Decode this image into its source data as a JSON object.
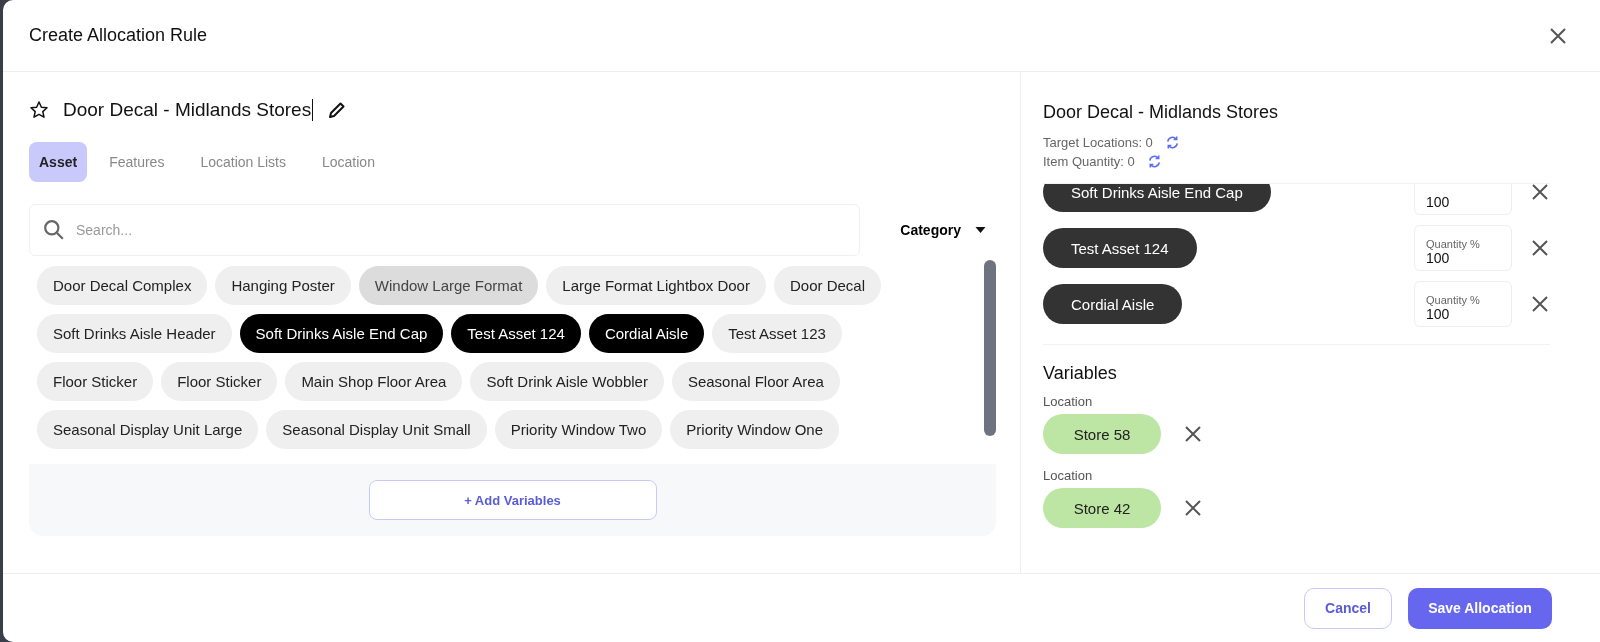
{
  "dialog": {
    "title": "Create Allocation Rule"
  },
  "rule": {
    "name": "Door Decal - Midlands Stores",
    "starred": false
  },
  "tabs": [
    {
      "label": "Asset",
      "selected": true
    },
    {
      "label": "Features",
      "selected": false
    },
    {
      "label": "Location Lists",
      "selected": false
    },
    {
      "label": "Location",
      "selected": false
    }
  ],
  "search": {
    "placeholder": "Search..."
  },
  "filter": {
    "label": "Category"
  },
  "assets": [
    {
      "label": "Door Decal Complex",
      "selected": false,
      "highlighted": false
    },
    {
      "label": "Hanging Poster",
      "selected": false,
      "highlighted": false
    },
    {
      "label": "Window Large Format",
      "selected": false,
      "highlighted": true
    },
    {
      "label": "Large Format Lightbox Door",
      "selected": false,
      "highlighted": false
    },
    {
      "label": "Door Decal",
      "selected": false,
      "highlighted": false
    },
    {
      "label": "Soft Drinks Aisle Header",
      "selected": false,
      "highlighted": false
    },
    {
      "label": "Soft Drinks Aisle End Cap",
      "selected": true,
      "highlighted": false
    },
    {
      "label": "Test Asset 124",
      "selected": true,
      "highlighted": false
    },
    {
      "label": "Cordial Aisle",
      "selected": true,
      "highlighted": false
    },
    {
      "label": "Test Asset 123",
      "selected": false,
      "highlighted": false
    },
    {
      "label": "Floor Sticker",
      "selected": false,
      "highlighted": false
    },
    {
      "label": "Floor Sticker",
      "selected": false,
      "highlighted": false
    },
    {
      "label": "Main Shop Floor Area",
      "selected": false,
      "highlighted": false
    },
    {
      "label": "Soft Drink Aisle Wobbler",
      "selected": false,
      "highlighted": false
    },
    {
      "label": "Seasonal Floor Area",
      "selected": false,
      "highlighted": false
    },
    {
      "label": "Seasonal Display Unit Large",
      "selected": false,
      "highlighted": false
    },
    {
      "label": "Seasonal Display Unit Small",
      "selected": false,
      "highlighted": false
    },
    {
      "label": "Priority Window Two",
      "selected": false,
      "highlighted": false
    },
    {
      "label": "Priority Window One",
      "selected": false,
      "highlighted": false
    }
  ],
  "add_variables": "+ Add Variables",
  "summary": {
    "title": "Door Decal - Midlands Stores",
    "target_locations": "Target Locations: 0",
    "item_quantity": "Item Quantity: 0"
  },
  "allocations": [
    {
      "asset": "Soft Drinks Aisle End Cap",
      "quantity": "100"
    },
    {
      "asset": "Test Asset 124",
      "quantity_label": "Quantity %",
      "quantity": "100"
    },
    {
      "asset": "Cordial Aisle",
      "quantity_label": "Quantity %",
      "quantity": "100"
    }
  ],
  "variables": {
    "title": "Variables",
    "items": [
      {
        "label": "Location",
        "value": "Store 58"
      },
      {
        "label": "Location",
        "value": "Store 42"
      }
    ]
  },
  "buttons": {
    "cancel": "Cancel",
    "save": "Save Allocation"
  }
}
